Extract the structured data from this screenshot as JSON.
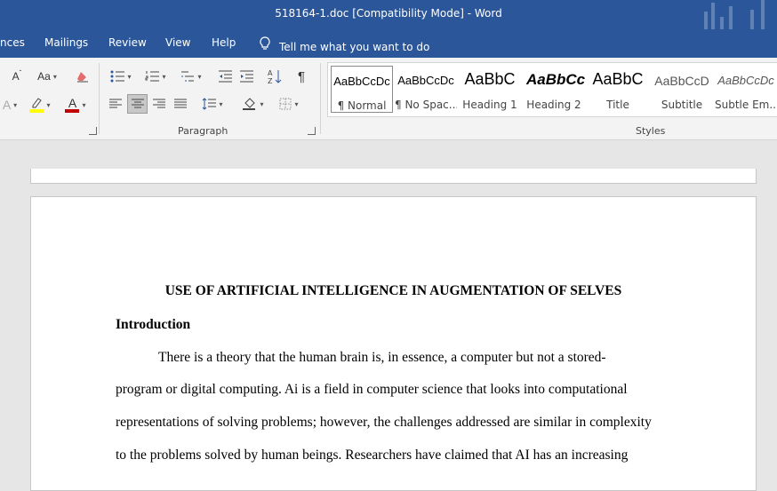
{
  "window": {
    "title": "518164-1.doc [Compatibility Mode]  -  Word"
  },
  "tabs": [
    {
      "label": "nces"
    },
    {
      "label": "Mailings"
    },
    {
      "label": "Review"
    },
    {
      "label": "View"
    },
    {
      "label": "Help"
    }
  ],
  "tell_me": {
    "label": "Tell me what you want to do"
  },
  "ribbon": {
    "font_group": {
      "font_size_label": "A",
      "change_case_label": "Aa"
    },
    "paragraph_group": {
      "label": "Paragraph"
    },
    "styles_group": {
      "label": "Styles",
      "items": [
        {
          "preview": "AaBbCcDc",
          "name": "¶ Normal",
          "selected": true
        },
        {
          "preview": "AaBbCcDc",
          "name": "¶ No Spac..."
        },
        {
          "preview": "AaBbC",
          "name": "Heading 1"
        },
        {
          "preview": "AaBbCc",
          "name": "Heading 2"
        },
        {
          "preview": "AaBbC",
          "name": "Title"
        },
        {
          "preview": "AaBbCcD",
          "name": "Subtitle"
        },
        {
          "preview": "AaBbCcDc",
          "name": "Subtle Em..."
        }
      ]
    }
  },
  "document": {
    "title": "USE OF ARTIFICIAL INTELLIGENCE IN AUGMENTATION OF SELVES",
    "heading": "Introduction",
    "lines": [
      "There is a theory that the human brain is, in essence, a computer but not a stored-",
      "program or digital computing. Ai is a field in computer science that looks into computational",
      "representations of solving problems; however, the challenges addressed are similar in complexity",
      "to the problems solved by human beings. Researchers have claimed that AI has an increasing"
    ]
  },
  "colors": {
    "accent": "#2b579a",
    "ribbon_bg": "#f3f3f3",
    "canvas_bg": "#e6e6e6",
    "highlight": "#ffff00",
    "font_color": "#c00000"
  }
}
